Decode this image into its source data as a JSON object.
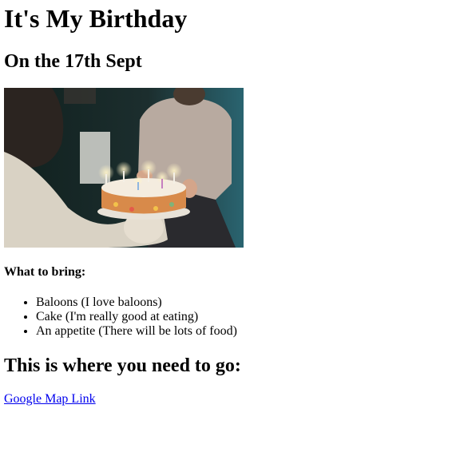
{
  "heading": "It's My Birthday",
  "subheading": "On the 17th Sept",
  "photo": {
    "icon": "birthday-cake-photo"
  },
  "bring": {
    "title": "What to bring:",
    "items": [
      "Baloons (I love baloons)",
      "Cake (I'm really good at eating)",
      "An appetite (There will be lots of food)"
    ]
  },
  "directions": {
    "title": "This is where you need to go:",
    "link_label": "Google Map Link"
  },
  "colors": {
    "link": "#0000ee",
    "text": "#000000",
    "background": "#ffffff"
  }
}
